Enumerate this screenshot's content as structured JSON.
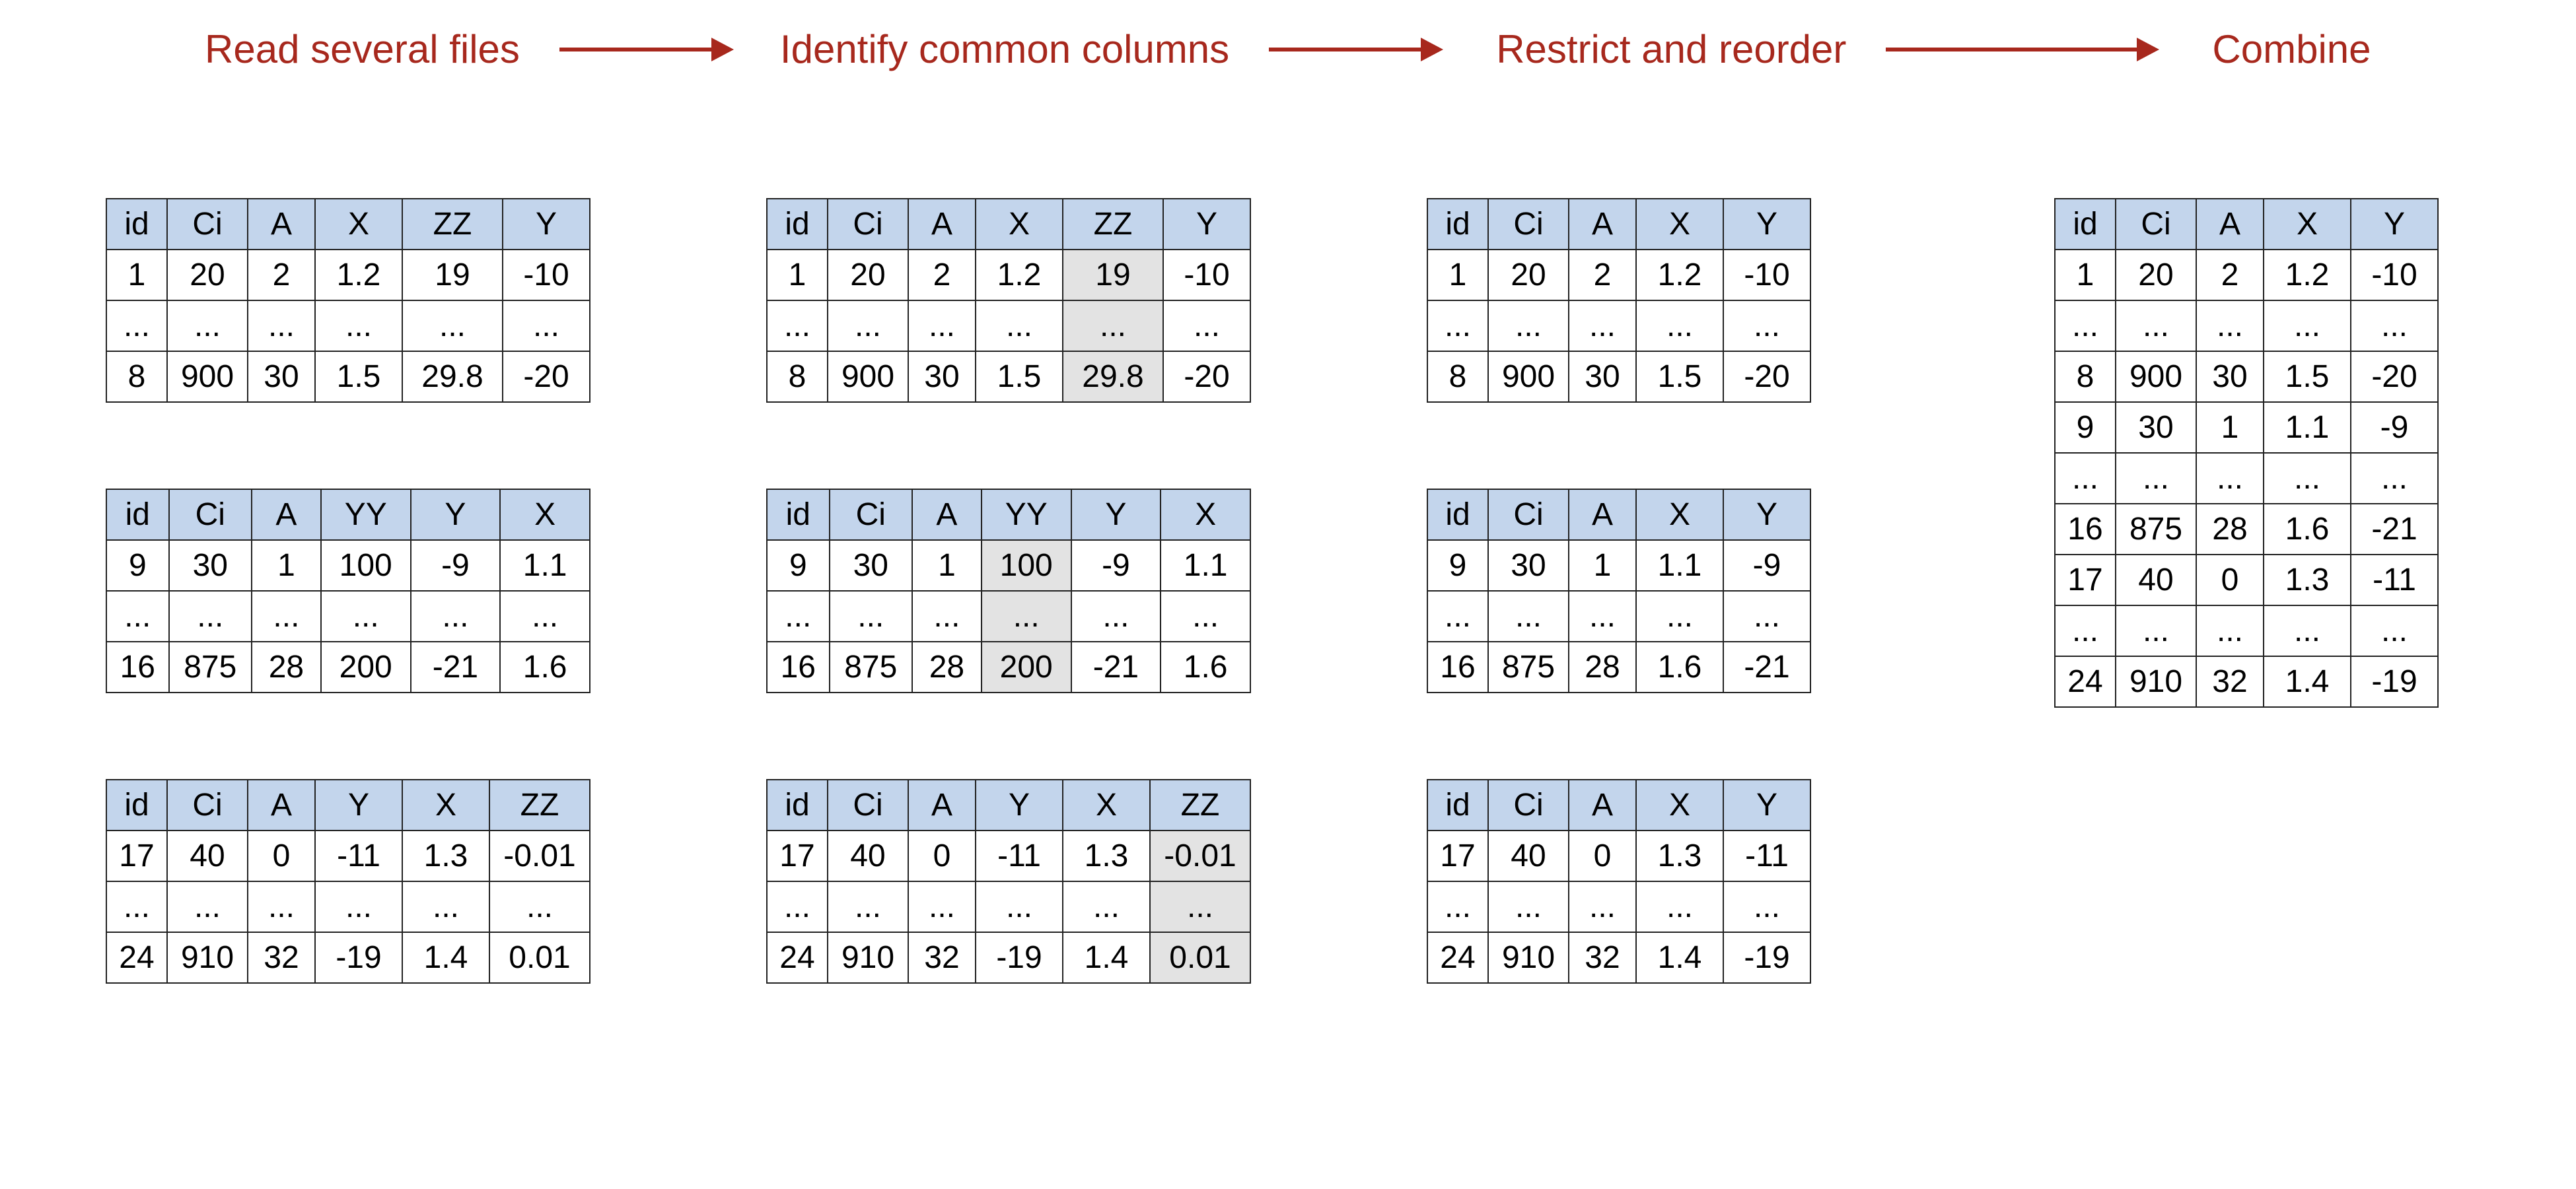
{
  "steps": {
    "read": "Read several files",
    "identify": "Identify common columns",
    "restrict": "Restrict and reorder",
    "combine": "Combine"
  },
  "read": {
    "t1": {
      "headers": [
        "id",
        "Ci",
        "A",
        "X",
        "ZZ",
        "Y"
      ],
      "r0": [
        "1",
        "20",
        "2",
        "1.2",
        "19",
        "-10"
      ],
      "r1": [
        "...",
        "...",
        "...",
        "...",
        "...",
        "..."
      ],
      "r2": [
        "8",
        "900",
        "30",
        "1.5",
        "29.8",
        "-20"
      ]
    },
    "t2": {
      "headers": [
        "id",
        "Ci",
        "A",
        "YY",
        "Y",
        "X"
      ],
      "r0": [
        "9",
        "30",
        "1",
        "100",
        "-9",
        "1.1"
      ],
      "r1": [
        "...",
        "...",
        "...",
        "...",
        "...",
        "..."
      ],
      "r2": [
        "16",
        "875",
        "28",
        "200",
        "-21",
        "1.6"
      ]
    },
    "t3": {
      "headers": [
        "id",
        "Ci",
        "A",
        "Y",
        "X",
        "ZZ"
      ],
      "r0": [
        "17",
        "40",
        "0",
        "-11",
        "1.3",
        "-0.01"
      ],
      "r1": [
        "...",
        "...",
        "...",
        "...",
        "...",
        "..."
      ],
      "r2": [
        "24",
        "910",
        "32",
        "-19",
        "1.4",
        "0.01"
      ]
    }
  },
  "identify": {
    "t1": {
      "headers": [
        "id",
        "Ci",
        "A",
        "X",
        "ZZ",
        "Y"
      ],
      "r0": [
        "1",
        "20",
        "2",
        "1.2",
        "19",
        "-10"
      ],
      "r1": [
        "...",
        "...",
        "...",
        "...",
        "...",
        "..."
      ],
      "r2": [
        "8",
        "900",
        "30",
        "1.5",
        "29.8",
        "-20"
      ],
      "hlCol": 4
    },
    "t2": {
      "headers": [
        "id",
        "Ci",
        "A",
        "YY",
        "Y",
        "X"
      ],
      "r0": [
        "9",
        "30",
        "1",
        "100",
        "-9",
        "1.1"
      ],
      "r1": [
        "...",
        "...",
        "...",
        "...",
        "...",
        "..."
      ],
      "r2": [
        "16",
        "875",
        "28",
        "200",
        "-21",
        "1.6"
      ],
      "hlCol": 3
    },
    "t3": {
      "headers": [
        "id",
        "Ci",
        "A",
        "Y",
        "X",
        "ZZ"
      ],
      "r0": [
        "17",
        "40",
        "0",
        "-11",
        "1.3",
        "-0.01"
      ],
      "r1": [
        "...",
        "...",
        "...",
        "...",
        "...",
        "..."
      ],
      "r2": [
        "24",
        "910",
        "32",
        "-19",
        "1.4",
        "0.01"
      ],
      "hlCol": 5
    }
  },
  "restrict": {
    "t1": {
      "headers": [
        "id",
        "Ci",
        "A",
        "X",
        "Y"
      ],
      "r0": [
        "1",
        "20",
        "2",
        "1.2",
        "-10"
      ],
      "r1": [
        "...",
        "...",
        "...",
        "...",
        "..."
      ],
      "r2": [
        "8",
        "900",
        "30",
        "1.5",
        "-20"
      ]
    },
    "t2": {
      "headers": [
        "id",
        "Ci",
        "A",
        "X",
        "Y"
      ],
      "r0": [
        "9",
        "30",
        "1",
        "1.1",
        "-9"
      ],
      "r1": [
        "...",
        "...",
        "...",
        "...",
        "..."
      ],
      "r2": [
        "16",
        "875",
        "28",
        "1.6",
        "-21"
      ]
    },
    "t3": {
      "headers": [
        "id",
        "Ci",
        "A",
        "X",
        "Y"
      ],
      "r0": [
        "17",
        "40",
        "0",
        "1.3",
        "-11"
      ],
      "r1": [
        "...",
        "...",
        "...",
        "...",
        "..."
      ],
      "r2": [
        "24",
        "910",
        "32",
        "1.4",
        "-19"
      ]
    }
  },
  "combine": {
    "headers": [
      "id",
      "Ci",
      "A",
      "X",
      "Y"
    ],
    "rows": [
      [
        "1",
        "20",
        "2",
        "1.2",
        "-10"
      ],
      [
        "...",
        "...",
        "...",
        "...",
        "..."
      ],
      [
        "8",
        "900",
        "30",
        "1.5",
        "-20"
      ],
      [
        "9",
        "30",
        "1",
        "1.1",
        "-9"
      ],
      [
        "...",
        "...",
        "...",
        "...",
        "..."
      ],
      [
        "16",
        "875",
        "28",
        "1.6",
        "-21"
      ],
      [
        "17",
        "40",
        "0",
        "1.3",
        "-11"
      ],
      [
        "...",
        "...",
        "...",
        "...",
        "..."
      ],
      [
        "24",
        "910",
        "32",
        "1.4",
        "-19"
      ]
    ]
  }
}
